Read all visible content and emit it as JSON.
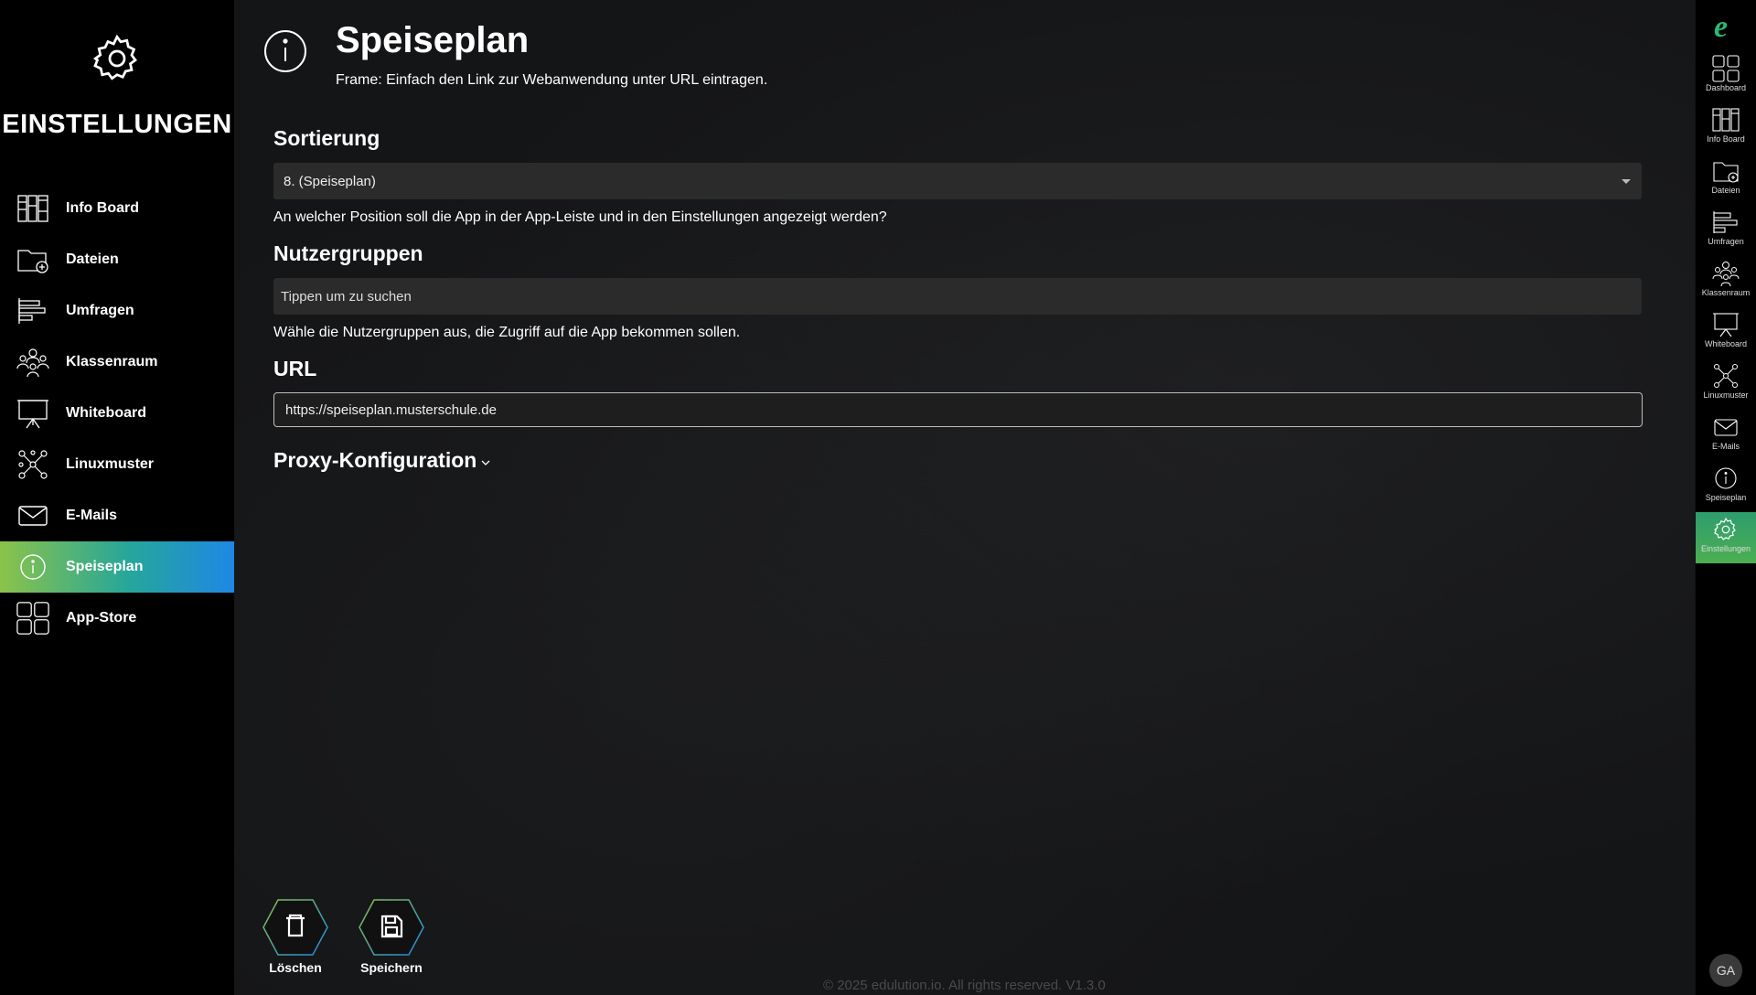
{
  "sidebar": {
    "title": "EINSTELLUNGEN",
    "items": [
      {
        "label": "Info Board",
        "icon": "info-board-icon"
      },
      {
        "label": "Dateien",
        "icon": "files-icon"
      },
      {
        "label": "Umfragen",
        "icon": "surveys-icon"
      },
      {
        "label": "Klassenraum",
        "icon": "classroom-icon"
      },
      {
        "label": "Whiteboard",
        "icon": "whiteboard-icon"
      },
      {
        "label": "Linuxmuster",
        "icon": "linuxmuster-icon"
      },
      {
        "label": "E-Mails",
        "icon": "mail-icon"
      },
      {
        "label": "Speiseplan",
        "icon": "info-icon",
        "active": true
      },
      {
        "label": "App-Store",
        "icon": "app-store-icon"
      }
    ]
  },
  "header": {
    "title": "Speiseplan",
    "subtitle": "Frame: Einfach den Link zur Webanwendung unter URL eintragen."
  },
  "form": {
    "sort_heading": "Sortierung",
    "sort_value": "8. (Speiseplan)",
    "sort_help": "An welcher Position soll die App in der App-Leiste und in den Einstellungen angezeigt werden?",
    "groups_heading": "Nutzergruppen",
    "groups_placeholder": "Tippen um zu suchen",
    "groups_help": "Wähle die Nutzergruppen aus, die Zugriff auf die App bekommen sollen.",
    "url_heading": "URL",
    "url_value": "https://speiseplan.musterschule.de",
    "proxy_heading": "Proxy-Konfiguration"
  },
  "actions": {
    "delete_label": "Löschen",
    "save_label": "Speichern"
  },
  "rail": {
    "items": [
      {
        "label": "Dashboard"
      },
      {
        "label": "Info Board"
      },
      {
        "label": "Dateien"
      },
      {
        "label": "Umfragen"
      },
      {
        "label": "Klassenraum"
      },
      {
        "label": "Whiteboard"
      },
      {
        "label": "Linuxmuster"
      },
      {
        "label": "E-Mails"
      },
      {
        "label": "Speiseplan"
      },
      {
        "label": "Einstellungen",
        "active": true
      }
    ],
    "avatar_initials": "GA"
  },
  "footer": {
    "text": "© 2025 edulution.io. All rights reserved. V1.3.0"
  },
  "colors": {
    "active_gradient_start": "#8bc34a",
    "active_gradient_end": "#1e88e5",
    "logo_green": "#2bb673"
  }
}
